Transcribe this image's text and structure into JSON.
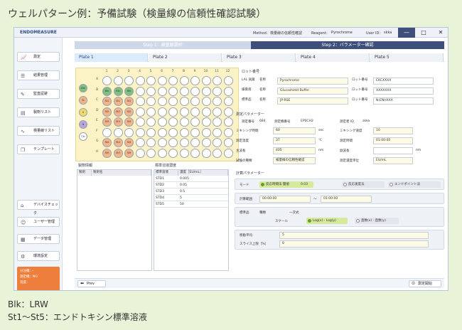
{
  "figure_title": "ウェルパターン例：予備試験（検量線の信頼性確認試験）",
  "captions": [
    "Blk：LRW",
    "St1～St5：エンドトキシン標準溶液"
  ],
  "window": {
    "app_name": "ENDOMEASURE",
    "method_label": "Method：",
    "method_value": "検量線の信頼性確認",
    "reagent_label": "Reagent：",
    "reagent_value": "Pyrochrome",
    "user_label": "User ID：",
    "user_value": "skka",
    "minimize": "—",
    "maximize": "□",
    "close": "✕"
  },
  "sidebar": {
    "items": [
      {
        "label": "測定",
        "icon": "chart-icon"
      },
      {
        "label": "結果管理",
        "icon": "list-icon"
      },
      {
        "label": "監査証跡",
        "icon": "audit-icon"
      },
      {
        "label": "製剤リスト",
        "icon": "book-icon"
      },
      {
        "label": "検量線リスト",
        "icon": "curve-icon"
      },
      {
        "label": "テンプレート",
        "icon": "copy-icon"
      }
    ],
    "bottom_items": [
      {
        "label": "デバイスチェック",
        "icon": "device-icon"
      },
      {
        "label": "ユーザー管理",
        "icon": "user-icon"
      },
      {
        "label": "データ管理",
        "icon": "database-icon"
      },
      {
        "label": "環境設定",
        "icon": "wrench-icon"
      }
    ],
    "status": [
      "分注機：・",
      "測定機：NG",
      "温度："
    ]
  },
  "steps": {
    "step1": "Step 1：検量線選択",
    "step2": "Step 2：パラメーター確認"
  },
  "tabs": [
    "Plate 1",
    "Plate 2",
    "Plate 3",
    "Plate 4",
    "Plate 5"
  ],
  "plate": {
    "col_labels": [
      "1",
      "2",
      "3",
      "4",
      "5",
      "6",
      "7",
      "8",
      "9",
      "10",
      "11",
      "12"
    ],
    "row_labels": [
      "A",
      "B",
      "C",
      "D",
      "E",
      "F",
      "G",
      "H"
    ],
    "legend": [
      "Blk",
      "St",
      "S",
      "N",
      "Ctr"
    ],
    "filled": [
      [
        "",
        "",
        "",
        "",
        "",
        "",
        "",
        "",
        "",
        "",
        "",
        ""
      ],
      [
        "Blk",
        "Blk",
        "Blk",
        "",
        "",
        "",
        "",
        "",
        "",
        "",
        "",
        ""
      ],
      [
        "St1",
        "St1",
        "St1",
        "",
        "",
        "",
        "",
        "",
        "",
        "",
        "",
        ""
      ],
      [
        "St2",
        "St2",
        "St2",
        "",
        "",
        "",
        "",
        "",
        "",
        "",
        "",
        ""
      ],
      [
        "St3",
        "St3",
        "St3",
        "",
        "",
        "",
        "",
        "",
        "",
        "",
        "",
        ""
      ],
      [
        "",
        "",
        "",
        "",
        "",
        "",
        "",
        "",
        "",
        "",
        "",
        ""
      ],
      [
        "St4",
        "St4",
        "St4",
        "",
        "",
        "",
        "",
        "",
        "",
        "",
        "",
        ""
      ],
      [
        "St5",
        "St5",
        "St5",
        "",
        "",
        "",
        "",
        "",
        "",
        "",
        "",
        ""
      ]
    ]
  },
  "drug_panel": {
    "title": "製剤情報",
    "headers": [
      "製剤",
      "製剤名"
    ]
  },
  "std_panel": {
    "title": "標準溶液濃度",
    "headers": [
      "標準溶液",
      "濃度［EU/mL］"
    ],
    "rows": [
      [
        "STD1",
        "0.005"
      ],
      [
        "STD2",
        "0.05"
      ],
      [
        "STD3",
        "0.5"
      ],
      [
        "STD4",
        "5"
      ],
      [
        "STD5",
        "50"
      ]
    ]
  },
  "lot": {
    "title": "ロット番号",
    "rows": [
      {
        "label": "LAL 試薬",
        "name_label": "名称",
        "name": "Pyrochrome",
        "lot_label": "ロット番号",
        "lot": "CKCXXXX"
      },
      {
        "label": "緩衝液",
        "name_label": "名称",
        "name": "Glucashield Buffer",
        "lot_label": "ロット番号",
        "lot": "XXXXXXX"
      },
      {
        "label": "標準品",
        "name_label": "名称",
        "name": "JP-RSE",
        "lot_label": "ロット番号",
        "lot": "N-ENHXXX"
      }
    ]
  },
  "measure": {
    "title": "測定パラメーター",
    "device_label": "測定番号",
    "device_value": "684",
    "machine_label": "測定機番号",
    "machine_value": "EP0CH2",
    "user_label": "測定者 ID",
    "user_value": "skka",
    "mix_label": "ミキシング時間",
    "mix_value": "60",
    "mix_unit": "sec",
    "mixspeed_label": "ミキシング速度",
    "mixspeed_value": "10",
    "temp_label": "測定温度",
    "temp_value": "37",
    "temp_unit": "℃",
    "time_label": "測定時間",
    "time_value": "01:00:00",
    "wave_label": "主波長",
    "wave_value": "405",
    "wave_unit": "nm",
    "subwave_label": "副波長",
    "subwave_value": "",
    "subwave_unit": "nm",
    "type_label": "試験の種類",
    "type_value": "検量線の信頼性確認",
    "unit_label": "測定濃度単位",
    "unit_value": "EU/mL"
  },
  "calc": {
    "title": "計算パラメーター",
    "mode_label": "モード",
    "mode_options": [
      "反応時間法 閾値",
      "反応速度法",
      "エンドポイント法"
    ],
    "threshold": "0.03",
    "range_label": "計算範囲",
    "range_from": "00:00:00",
    "range_sep": "～",
    "range_to": "01:00:00",
    "std_label": "標準品",
    "std_type_label": "種類",
    "std_type_value": "一次式",
    "scale_label": "スケール",
    "scale_options": [
      "Log(x) - Log(y)",
      "直数(x) - 直数(y)"
    ],
    "avg_label": "移動平均",
    "avg_value": "5",
    "slice_label": "スライス上限［%］",
    "slice_value": "0"
  },
  "footer": {
    "prev": "Prev",
    "start": "測定開始"
  },
  "colors": {
    "blk": "#7fbf7f",
    "st": "#f2b48a",
    "s": "#f2d96a",
    "n": "#b9a6d9",
    "plate_bg": "#fbf2c6"
  }
}
